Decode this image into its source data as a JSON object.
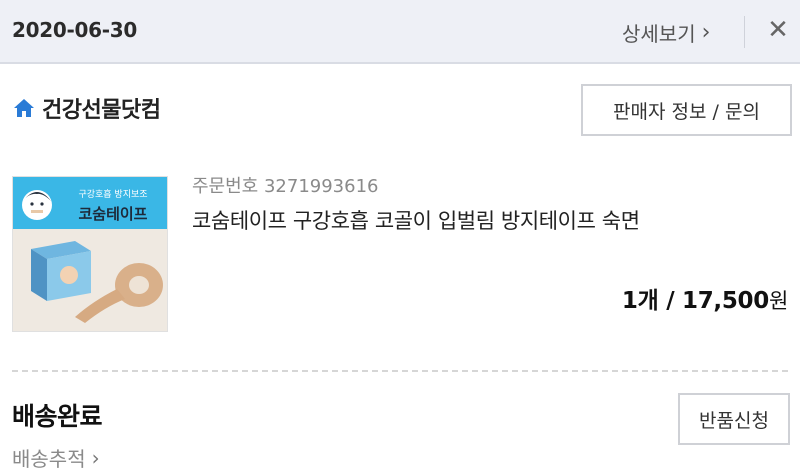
{
  "header": {
    "date": "2020-06-30",
    "detail_label": "상세보기",
    "close_symbol": "✕"
  },
  "store": {
    "name": "건강선물닷컴",
    "icon": "home-icon",
    "seller_button_label": "판매자 정보 / 문의"
  },
  "order": {
    "order_number_label": "주문번호 3271993616",
    "product_name": "코숨테이프 구강호흡 코골이 입벌림 방지테이프 숙면",
    "price_quantity": "1개 / 17,500",
    "price_unit": "원",
    "thumbnail": {
      "banner_subtitle": "구강호흡 방지보조",
      "banner_title": "코숨테이프",
      "banner_color": "#3ab7e6"
    }
  },
  "delivery": {
    "status": "배송완료",
    "tracking_label": "배송추적",
    "return_button_label": "반품신청"
  },
  "colors": {
    "accent_blue": "#2a7bd6",
    "header_bg": "#eef0f6"
  }
}
